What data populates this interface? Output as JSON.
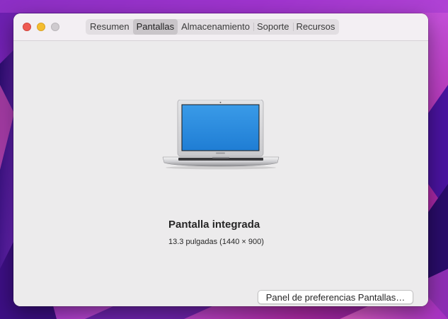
{
  "window": {
    "tabs": [
      {
        "label": "Resumen",
        "active": false
      },
      {
        "label": "Pantallas",
        "active": true
      },
      {
        "label": "Almacenamiento",
        "active": false
      },
      {
        "label": "Soporte",
        "active": false
      },
      {
        "label": "Recursos",
        "active": false
      }
    ]
  },
  "display": {
    "name": "Pantalla integrada",
    "spec": "13.3 pulgadas (1440 × 900)",
    "icon": "macbook-air-icon"
  },
  "actions": {
    "prefs_button_label": "Panel de preferencias Pantallas…"
  },
  "colors": {
    "close": "#ee5a52",
    "minimize": "#f4bd2f",
    "zoom": "#cfcbcf",
    "screen": "#2f8fe0"
  }
}
